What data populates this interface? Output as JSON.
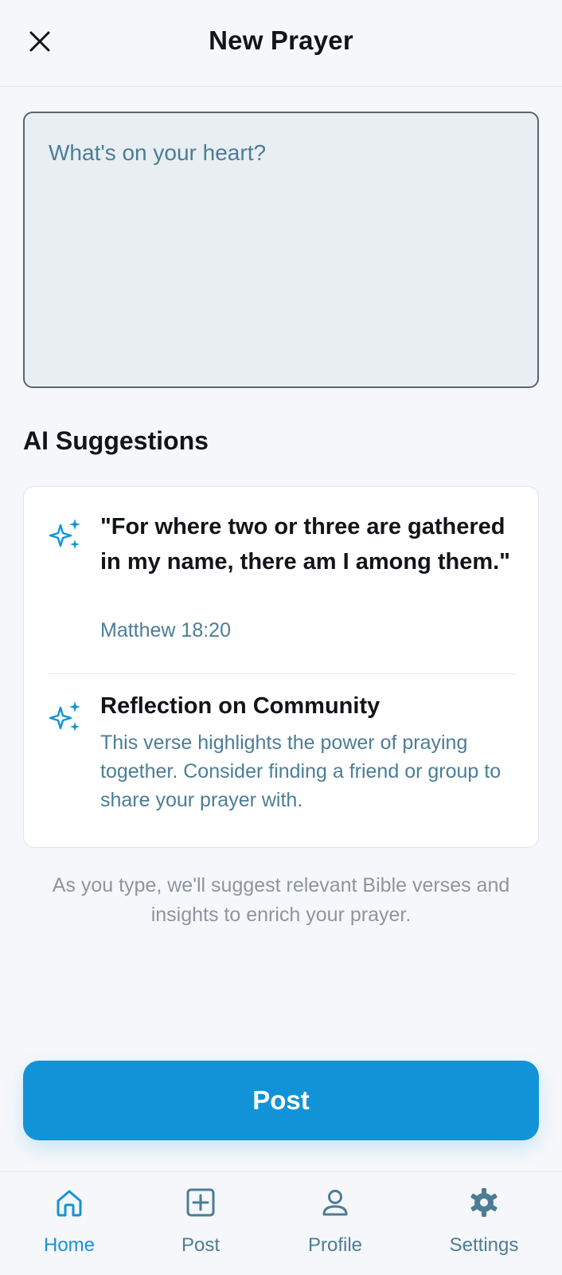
{
  "header": {
    "title": "New Prayer",
    "close_icon": "close-icon"
  },
  "composer": {
    "placeholder": "What's on your heart?",
    "value": ""
  },
  "suggestions": {
    "title": "AI Suggestions",
    "icon": "sparkles-icon",
    "items": [
      {
        "title": "\"For where two or three are gathered in my name, there am I among them.\"",
        "subtitle": "Matthew 18:20"
      },
      {
        "title": "Reflection on Community",
        "subtitle": "This verse highlights the power of praying together. Consider finding a friend or group to share your prayer with."
      }
    ],
    "hint": "As you type, we'll suggest relevant Bible verses and insights to enrich your prayer."
  },
  "actions": {
    "post_label": "Post"
  },
  "nav": {
    "items": [
      {
        "label": "Home",
        "icon": "home-icon",
        "active": true
      },
      {
        "label": "Post",
        "icon": "plus-square-icon",
        "active": false
      },
      {
        "label": "Profile",
        "icon": "user-icon",
        "active": false
      },
      {
        "label": "Settings",
        "icon": "gear-icon",
        "active": false
      }
    ]
  },
  "colors": {
    "accent": "#1393d7",
    "muted_blue": "#4c7d96",
    "background": "#f6f7fa"
  }
}
